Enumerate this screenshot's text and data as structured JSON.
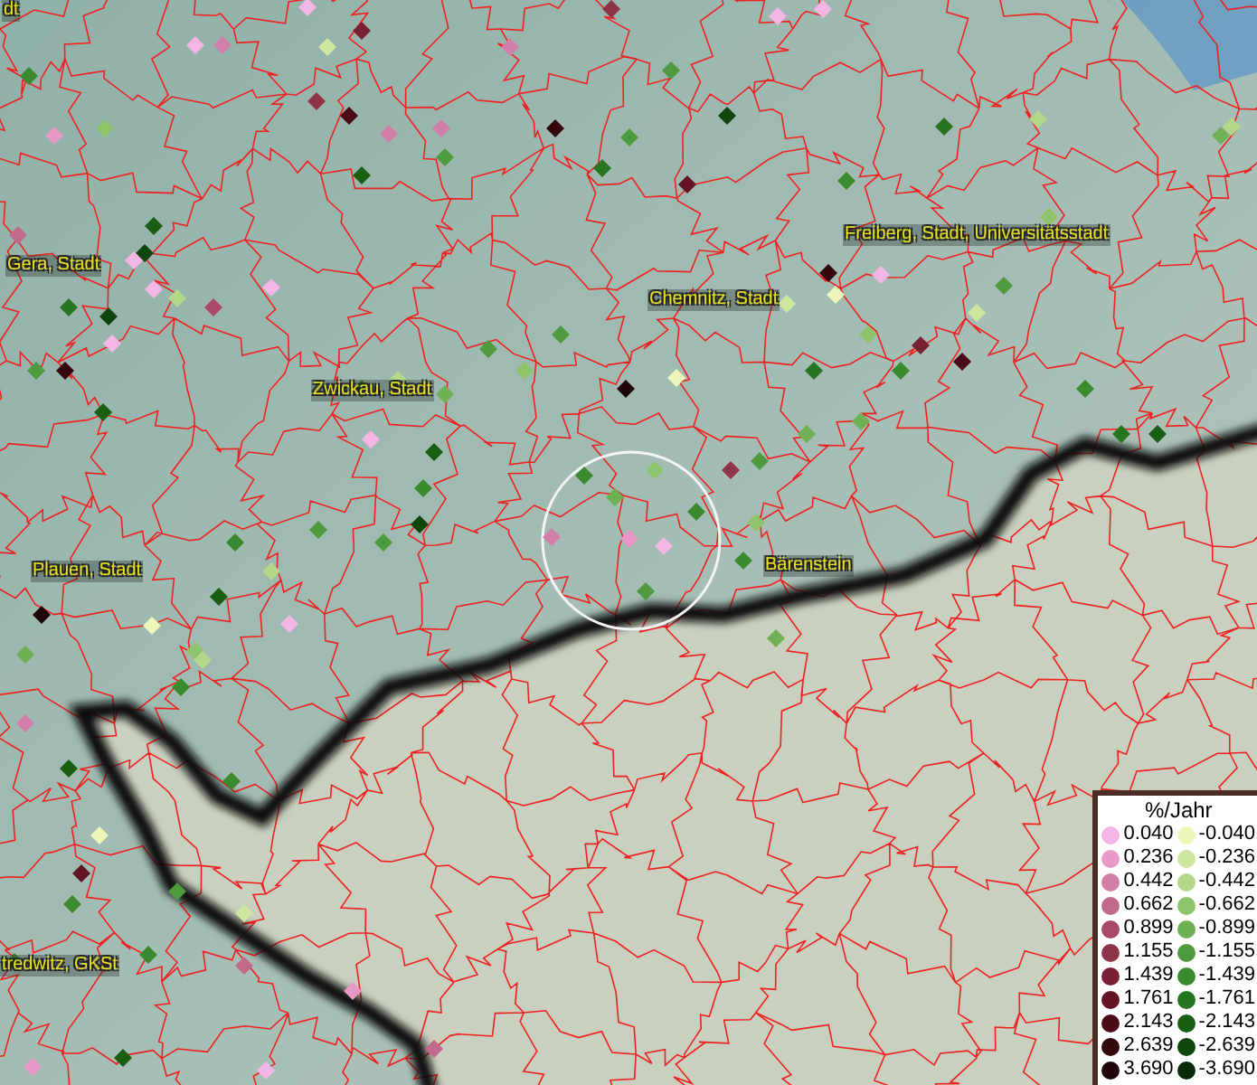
{
  "map": {
    "place_labels": [
      "dt",
      "Gera, Stadt",
      "Zwickau, Stadt",
      "Chemnitz, Stadt",
      "Freiberg, Stadt, Universitätsstadt",
      "Plauen, Stadt",
      "Bärenstein",
      "tredwitz, GKSt"
    ]
  },
  "legend": {
    "title": "%/Jahr",
    "rows": [
      {
        "entries": [
          {
            "value": "0.040",
            "color": "#f4b6e4"
          },
          {
            "value": "-0.040",
            "color": "#eef5b8"
          }
        ]
      },
      {
        "entries": [
          {
            "value": "0.236",
            "color": "#e79ac8"
          },
          {
            "value": "-0.236",
            "color": "#cfe6a0"
          }
        ]
      },
      {
        "entries": [
          {
            "value": "0.442",
            "color": "#d17fa8"
          },
          {
            "value": "-0.442",
            "color": "#b0d888"
          }
        ]
      },
      {
        "entries": [
          {
            "value": "0.662",
            "color": "#c06a8c"
          },
          {
            "value": "-0.662",
            "color": "#8fc46c"
          }
        ]
      },
      {
        "entries": [
          {
            "value": "0.899",
            "color": "#a84a68"
          },
          {
            "value": "-0.899",
            "color": "#6fb055"
          }
        ]
      },
      {
        "entries": [
          {
            "value": "1.155",
            "color": "#8e3448"
          },
          {
            "value": "-1.155",
            "color": "#4f9a3e"
          }
        ]
      },
      {
        "entries": [
          {
            "value": "1.439",
            "color": "#7a2034"
          },
          {
            "value": "-1.439",
            "color": "#3a8a30"
          }
        ]
      },
      {
        "entries": [
          {
            "value": "1.761",
            "color": "#621424"
          },
          {
            "value": "-1.761",
            "color": "#267520"
          }
        ]
      },
      {
        "entries": [
          {
            "value": "2.143",
            "color": "#4a0a16"
          },
          {
            "value": "-2.143",
            "color": "#185f14"
          }
        ]
      },
      {
        "entries": [
          {
            "value": "2.639",
            "color": "#34060e"
          },
          {
            "value": "-2.639",
            "color": "#0e460c"
          }
        ]
      },
      {
        "entries": [
          {
            "value": "3.690",
            "color": "#200408"
          },
          {
            "value": "-3.690",
            "color": "#082a06"
          }
        ]
      }
    ]
  }
}
